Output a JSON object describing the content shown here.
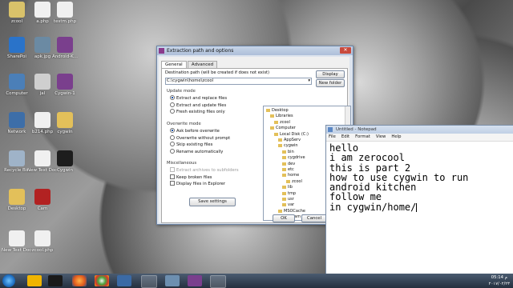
{
  "desktop": {
    "icons": [
      {
        "label": "zcool",
        "color": "#d9c26a"
      },
      {
        "label": "a.php",
        "color": "#f0f0f0"
      },
      {
        "label": "testm.php",
        "color": "#f0f0f0"
      },
      {
        "label": "SharePoi",
        "color": "#2a73c9"
      },
      {
        "label": "apk.jpg",
        "color": "#6b8aa3"
      },
      {
        "label": "Android-K...",
        "color": "#7a3f8d"
      },
      {
        "label": "Computer",
        "color": "#4b7fb8"
      },
      {
        "label": "jal",
        "color": "#cfcfcf"
      },
      {
        "label": "Cygwin-1",
        "color": "#7a3f8d"
      },
      {
        "label": "Network",
        "color": "#3d6ea8"
      },
      {
        "label": "b214.php",
        "color": "#f0f0f0"
      },
      {
        "label": "cygwin",
        "color": "#e3c05a"
      },
      {
        "label": "Recycle Bin",
        "color": "#9fb3c8"
      },
      {
        "label": "New Text Document",
        "color": "#f0f0f0"
      },
      {
        "label": "Cygwin",
        "color": "#1d1d1d"
      },
      {
        "label": "Desktop",
        "color": "#e3c05a"
      },
      {
        "label": "Cam",
        "color": "#b22222"
      },
      {
        "label": "New Text Document",
        "color": "#f0f0f0"
      },
      {
        "label": "zcool.php",
        "color": "#f0f0f0"
      }
    ]
  },
  "dialog": {
    "title": "Extraction path and options",
    "tabs": [
      "General",
      "Advanced"
    ],
    "dest_label": "Destination path (will be created if does not exist)",
    "dest_value": "C:\\cygwin\\home\\zcool",
    "display_btn": "Display",
    "new_folder_btn": "New folder",
    "update_mode": {
      "label": "Update mode",
      "options": [
        "Extract and replace files",
        "Extract and update files",
        "Fresh existing files only"
      ],
      "selected": 0
    },
    "overwrite_mode": {
      "label": "Overwrite mode",
      "options": [
        "Ask before overwrite",
        "Overwrite without prompt",
        "Skip existing files",
        "Rename automatically"
      ],
      "selected": 0
    },
    "misc": {
      "label": "Miscellaneous",
      "options": [
        "Extract archives to subfolders",
        "Keep broken files",
        "Display files in Explorer"
      ]
    },
    "save_btn": "Save settings",
    "ok_btn": "OK",
    "cancel_btn": "Cancel",
    "tree": [
      "Desktop",
      "Libraries",
      "zcool",
      "Computer",
      "Local Disk (C:)",
      "AppServ",
      "cygwin",
      "bin",
      "cygdrive",
      "dev",
      "etc",
      "home",
      "zcool",
      "lib",
      "tmp",
      "usr",
      "var",
      "MSOCache",
      "Program Files"
    ]
  },
  "notepad": {
    "title": "Untitled - Notepad",
    "menu": [
      "File",
      "Edit",
      "Format",
      "View",
      "Help"
    ],
    "lines": [
      "hello",
      "i am zerocool",
      "this is part 2",
      "how to use cygwin to run",
      "android kitchen",
      "follow me",
      "in cygwin/home/"
    ]
  },
  "taskbar": {
    "time": "05:14 م",
    "date": "۲۰۱۷/۰۲/۲۳"
  }
}
